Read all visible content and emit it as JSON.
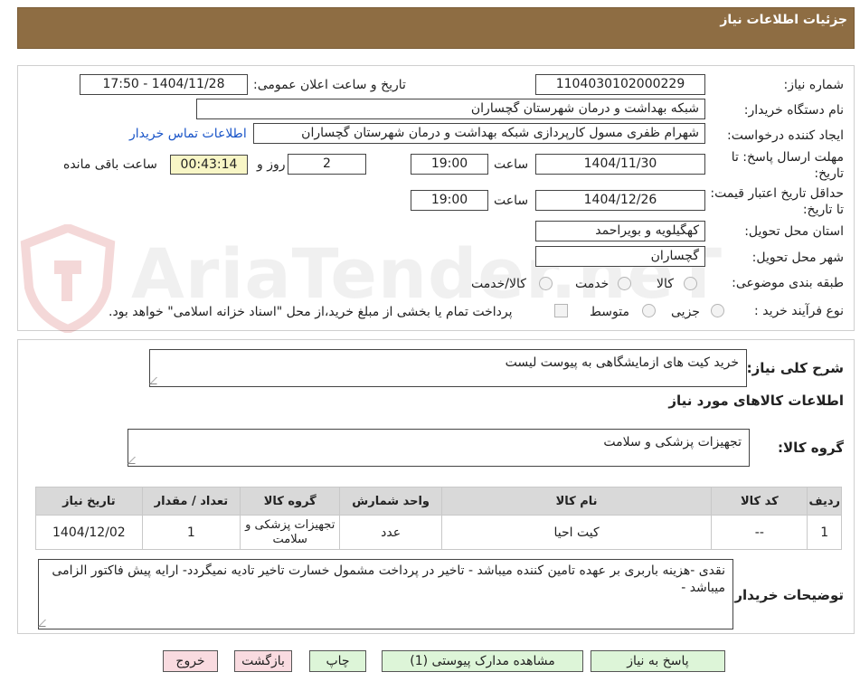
{
  "header": {
    "title": "جزئیات اطلاعات نیاز"
  },
  "watermark": {
    "text": "AriaTender.neT"
  },
  "fields": {
    "need_number_label": "شماره نیاز:",
    "need_number": "1104030102000229",
    "announce_label": "تاریخ و ساعت اعلان عمومی:",
    "announce_value": "1404/11/28 - 17:50",
    "buyer_org_label": "نام دستگاه خریدار:",
    "buyer_org": "شبکه بهداشت و درمان شهرستان گچساران",
    "creator_label": "ایجاد کننده درخواست:",
    "creator": "شهرام ظفری مسول کارپردازی  شبکه بهداشت و درمان شهرستان گچساران",
    "contact_link": "اطلاعات تماس خریدار",
    "reply_deadline_label": "مهلت ارسال پاسخ: تا تاریخ:",
    "reply_date": "1404/11/30",
    "time_label": "ساعت",
    "reply_time": "19:00",
    "days_value": "2",
    "days_label": "روز و",
    "remaining_time": "00:43:14",
    "remaining_label": "ساعت باقی مانده",
    "validity_label": "حداقل تاریخ اعتبار قیمت: تا تاریخ:",
    "validity_date": "1404/12/26",
    "validity_time": "19:00",
    "province_label": "استان محل تحویل:",
    "province": "کهگیلویه و بویراحمد",
    "city_label": "شهر محل تحویل:",
    "city": "گچساران",
    "category_label": "طبقه بندی موضوعی:",
    "category_options": [
      "کالا",
      "خدمت",
      "کالا/خدمت"
    ],
    "process_label": "نوع فرآیند خرید :",
    "process_options": [
      "جزیی",
      "متوسط"
    ],
    "treasury_note": "پرداخت تمام یا بخشی از مبلغ خرید،از محل \"اسناد خزانه اسلامی\" خواهد بود."
  },
  "description": {
    "label": "شرح کلی نیاز:",
    "value": "خرید کیت های ازمایشگاهی به پیوست لیست"
  },
  "goods_info": {
    "title": "اطلاعات کالاهای مورد نیاز",
    "group_label": "گروه کالا:",
    "group_value": "تجهیزات پزشکی و سلامت"
  },
  "table": {
    "headers": [
      "ردیف",
      "کد کالا",
      "نام کالا",
      "واحد شمارش",
      "گروه کالا",
      "تعداد / مقدار",
      "تاریخ نیاز"
    ],
    "rows": [
      [
        "1",
        "--",
        "کیت احیا",
        "عدد",
        "تجهیزات پزشکی و سلامت",
        "1",
        "1404/12/02"
      ]
    ]
  },
  "buyer_notes": {
    "label": "توضیحات خریدار:",
    "value": "نقدی -هزینه باربری بر عهده تامین کننده میباشد - تاخیر در پرداخت مشمول خسارت تاخیر تادیه نمیگردد- ارایه پیش فاکتور الزامی میباشد -"
  },
  "buttons": {
    "reply": "پاسخ به نیاز",
    "attachments": "مشاهده مدارک پیوستی (1)",
    "print": "چاپ",
    "back": "بازگشت",
    "exit": "خروج"
  }
}
